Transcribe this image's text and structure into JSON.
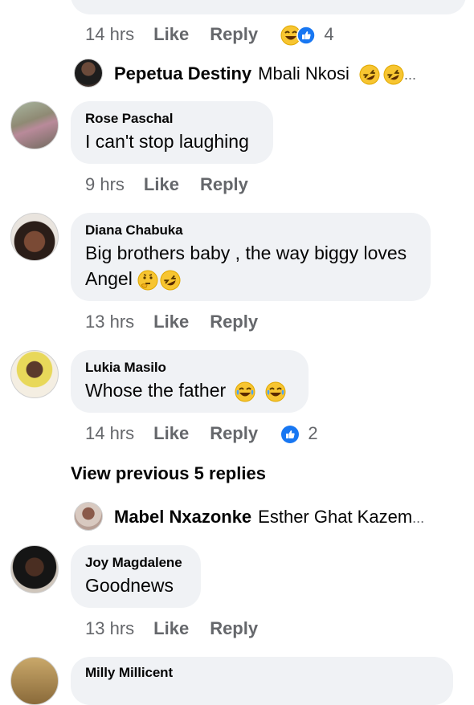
{
  "top_comment": {
    "time": "14 hrs",
    "like": "Like",
    "reply": "Reply",
    "reaction_count": "4"
  },
  "reply_preview_1": {
    "name": "Pepetua Destiny",
    "text": "Mbali Nkosi",
    "ellipsis": "..."
  },
  "comments": [
    {
      "name": "Rose Paschal",
      "text": "I can't stop laughing",
      "time": "9 hrs",
      "like": "Like",
      "reply": "Reply"
    },
    {
      "name": "Diana Chabuka",
      "text_line1": "Big brothers baby , the way biggy loves",
      "text_line2": "Angel",
      "time": "13 hrs",
      "like": "Like",
      "reply": "Reply"
    },
    {
      "name": "Lukia Masilo",
      "text": "Whose the father",
      "time": "14 hrs",
      "like": "Like",
      "reply": "Reply",
      "reaction_count": "2"
    },
    {
      "name": "Joy Magdalene",
      "text": "Goodnews",
      "time": "13 hrs",
      "like": "Like",
      "reply": "Reply"
    },
    {
      "name": "Milly Millicent"
    }
  ],
  "view_previous": "View previous 5 replies",
  "reply_preview_2": {
    "name": "Mabel Nxazonke",
    "text": "Esther Ghat Kazem",
    "ellipsis": "..."
  },
  "colors": {
    "bubble": "#f0f2f5",
    "meta": "#65676b",
    "like_blue": "#1877f2",
    "emoji_yellow": "#f7c531"
  },
  "icons": [
    "laughing-emoji-icon",
    "like-reaction-icon",
    "rofl-emoji-icon",
    "thinking-emoji-icon",
    "joy-emoji-icon"
  ]
}
